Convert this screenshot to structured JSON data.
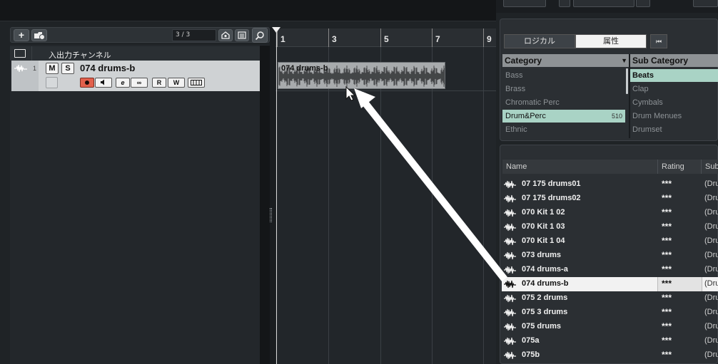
{
  "tracklist_toolbar": {
    "add_label": "+",
    "counter": "3 / 3"
  },
  "tracklist": {
    "folder_name": "入出力チャンネル",
    "track": {
      "number": "1",
      "name": "074 drums-b",
      "mute_label": "M",
      "solo_label": "S",
      "read_label": "R",
      "write_label": "W",
      "edit_label": "e",
      "link_label": "∞"
    }
  },
  "ruler": {
    "bars": [
      "1",
      "3",
      "5",
      "7",
      "9"
    ]
  },
  "event": {
    "name": "074 drums-b"
  },
  "mediabay": {
    "tabs": [
      "ロジカル",
      "属性"
    ],
    "back_label": "⏮",
    "category_header": "Category",
    "subcategory_header": "Sub Category",
    "categories": [
      {
        "label": "Bass"
      },
      {
        "label": "Brass"
      },
      {
        "label": "Chromatic Perc"
      },
      {
        "label": "Drum&Perc",
        "count": "510",
        "selected": true
      },
      {
        "label": "Ethnic"
      }
    ],
    "subcategories": [
      {
        "label": "Beats",
        "selected": true
      },
      {
        "label": "Clap"
      },
      {
        "label": "Cymbals"
      },
      {
        "label": "Drum Menues"
      },
      {
        "label": "Drumset"
      }
    ],
    "columns": [
      "Name",
      "Rating",
      "Sub"
    ],
    "results": [
      {
        "name": "07 175 drums01",
        "rating": "***",
        "sub": "(Dru"
      },
      {
        "name": "07 175 drums02",
        "rating": "***",
        "sub": "(Dru"
      },
      {
        "name": "070 Kit 1 02",
        "rating": "***",
        "sub": "(Dru"
      },
      {
        "name": "070 Kit 1 03",
        "rating": "***",
        "sub": "(Dru"
      },
      {
        "name": "070 Kit 1 04",
        "rating": "***",
        "sub": "(Dru"
      },
      {
        "name": "073 drums",
        "rating": "***",
        "sub": "(Dru"
      },
      {
        "name": "074 drums-a",
        "rating": "***",
        "sub": "(Dru"
      },
      {
        "name": "074 drums-b",
        "rating": "***",
        "sub": "(Dru",
        "selected": true
      },
      {
        "name": "075 2 drums",
        "rating": "***",
        "sub": "(Dru"
      },
      {
        "name": "075 3 drums",
        "rating": "***",
        "sub": "(Dru"
      },
      {
        "name": "075 drums",
        "rating": "***",
        "sub": "(Dru"
      },
      {
        "name": "075a",
        "rating": "***",
        "sub": "(Dru"
      },
      {
        "name": "075b",
        "rating": "***",
        "sub": "(Dru"
      }
    ]
  },
  "colors": {
    "selection": "#a9d3c5",
    "record": "#e2604c",
    "panel": "#2b2f33"
  }
}
